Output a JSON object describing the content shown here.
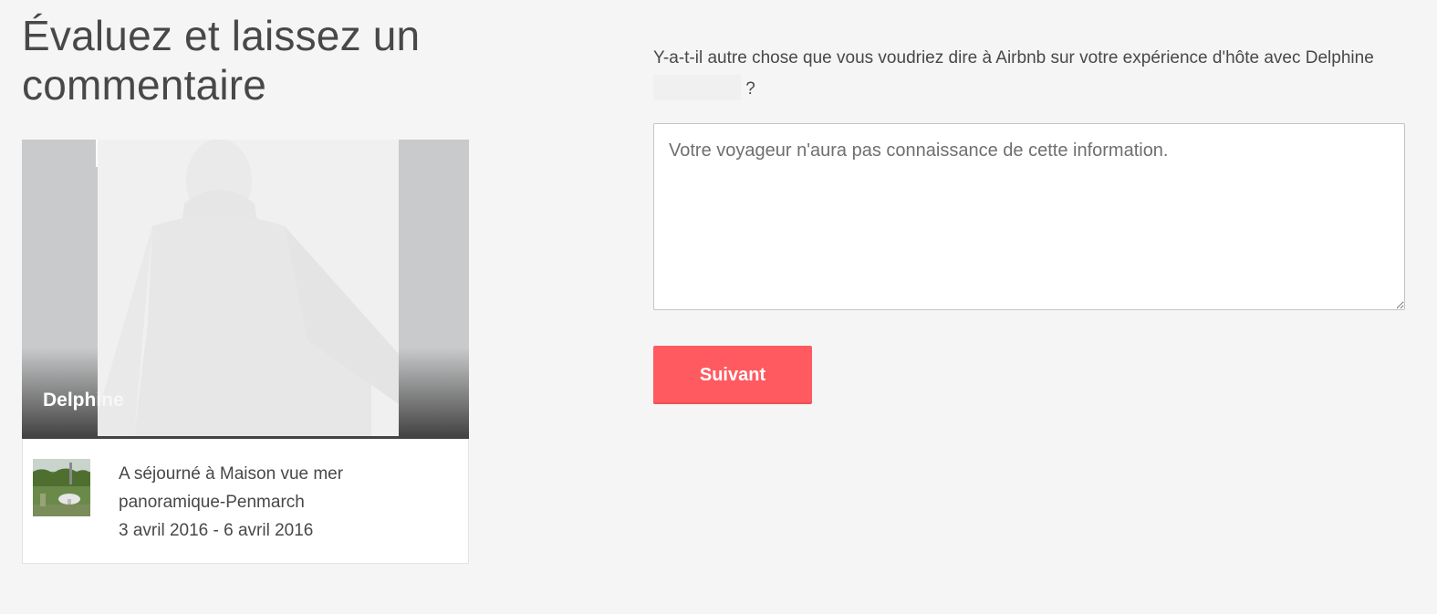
{
  "page": {
    "title": "Évaluez et laissez un commentaire"
  },
  "guest": {
    "name": "Delphine",
    "listing_line1": "A séjourné à Maison vue mer",
    "listing_line2": "panoramique-Penmarch",
    "dates": "3 avril 2016 - 6 avril 2016"
  },
  "feedback": {
    "question_part1": "Y-a-t-il autre chose que vous voudriez dire à Airbnb sur votre expérience d'hôte avec Delphine",
    "question_part2": " ?",
    "placeholder": "Votre voyageur n'aura pas connaissance de cette information.",
    "value": ""
  },
  "actions": {
    "next_label": "Suivant"
  },
  "colors": {
    "primary": "#ff5a5f",
    "text": "#484848",
    "background": "#f5f5f5"
  }
}
